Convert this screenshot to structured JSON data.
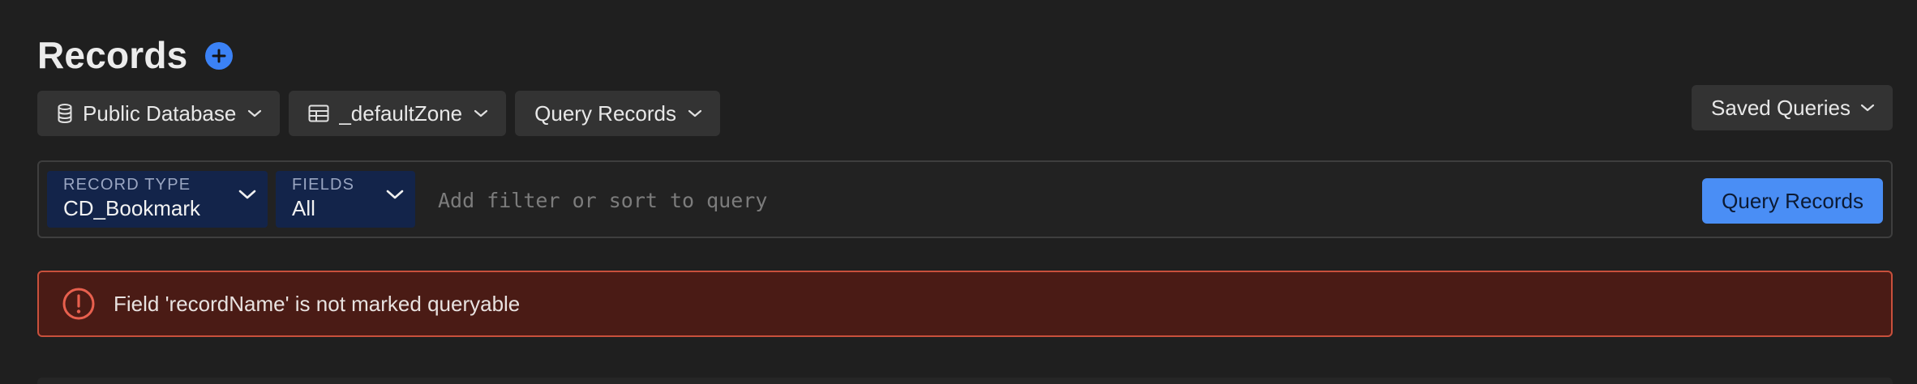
{
  "header": {
    "title": "Records",
    "add_icon": "plus-circle-icon",
    "accent_color": "#3b82f6"
  },
  "selectors": {
    "database": {
      "label": "Public Database",
      "icon": "database-icon"
    },
    "zone": {
      "label": "_defaultZone",
      "icon": "table-icon"
    },
    "operation": {
      "label": "Query Records"
    }
  },
  "saved_queries": {
    "label": "Saved Queries"
  },
  "query_bar": {
    "record_type": {
      "label": "RECORD TYPE",
      "value": "CD_Bookmark"
    },
    "fields": {
      "label": "FIELDS",
      "value": "All"
    },
    "filter_placeholder": "Add filter or sort to query",
    "submit_label": "Query Records"
  },
  "error": {
    "icon": "alert-circle-icon",
    "message": "Field 'recordName' is not marked queryable",
    "color": "#c8503c"
  }
}
